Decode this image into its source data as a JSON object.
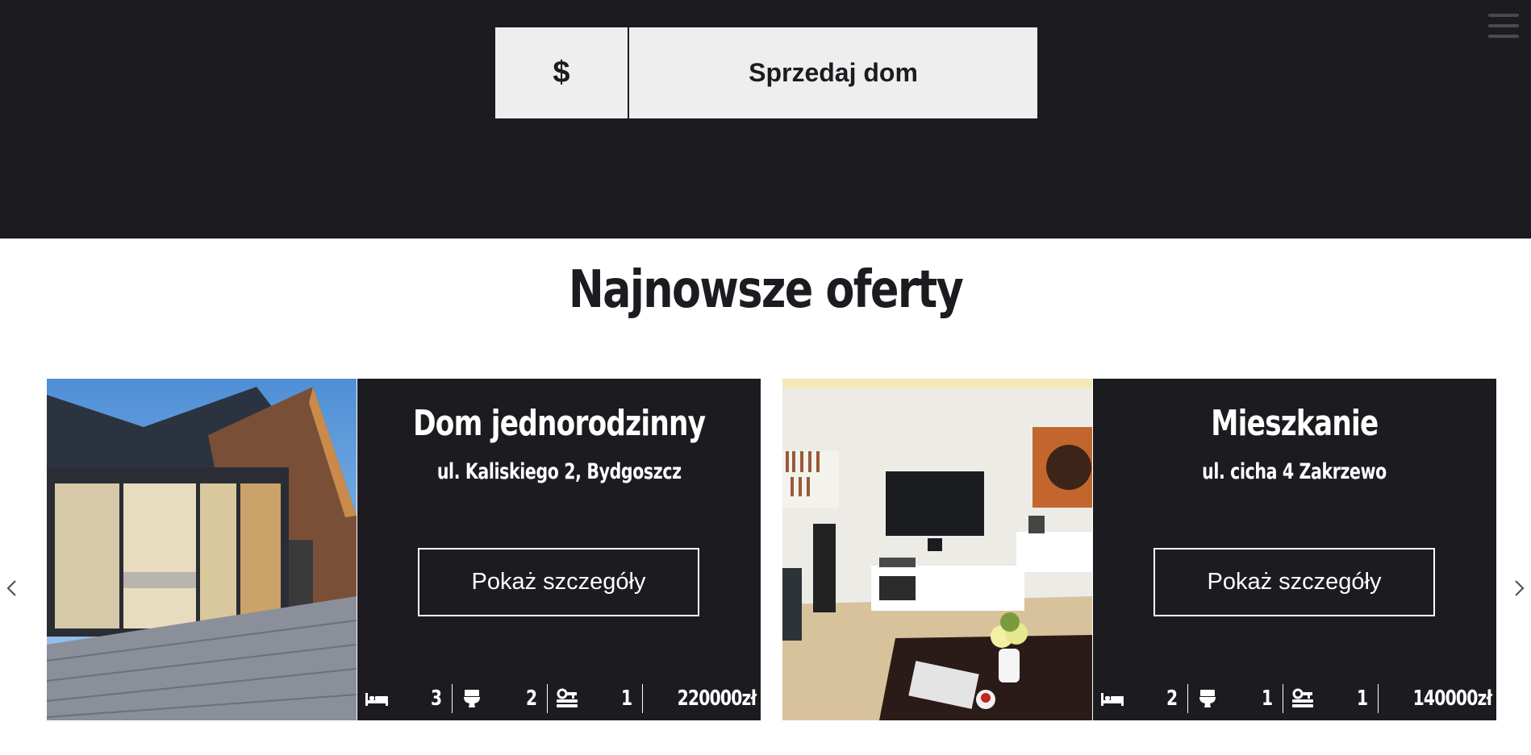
{
  "header": {
    "sell_button": {
      "currency_symbol": "$",
      "label": "Sprzedaj dom"
    },
    "menu_icon": "hamburger-icon"
  },
  "section": {
    "title": "Najnowsze oferty"
  },
  "carousel": {
    "prev_icon": "chevron-left-icon",
    "next_icon": "chevron-right-icon",
    "offers": [
      {
        "title": "Dom jednorodzinny",
        "address": "ul. Kaliskiego 2, Bydgoszcz",
        "details_label": "Pokaż szczegóły",
        "bedrooms": "3",
        "bathrooms": "2",
        "garages": "1",
        "price": "220000zł"
      },
      {
        "title": "Mieszkanie",
        "address": "ul. cicha 4 Zakrzewo",
        "details_label": "Pokaż szczegóły",
        "bedrooms": "2",
        "bathrooms": "1",
        "garages": "1",
        "price": "140000zł"
      }
    ]
  },
  "colors": {
    "dark": "#1c1b20",
    "light_button": "#eeeeee",
    "text_light": "#ffffff"
  }
}
